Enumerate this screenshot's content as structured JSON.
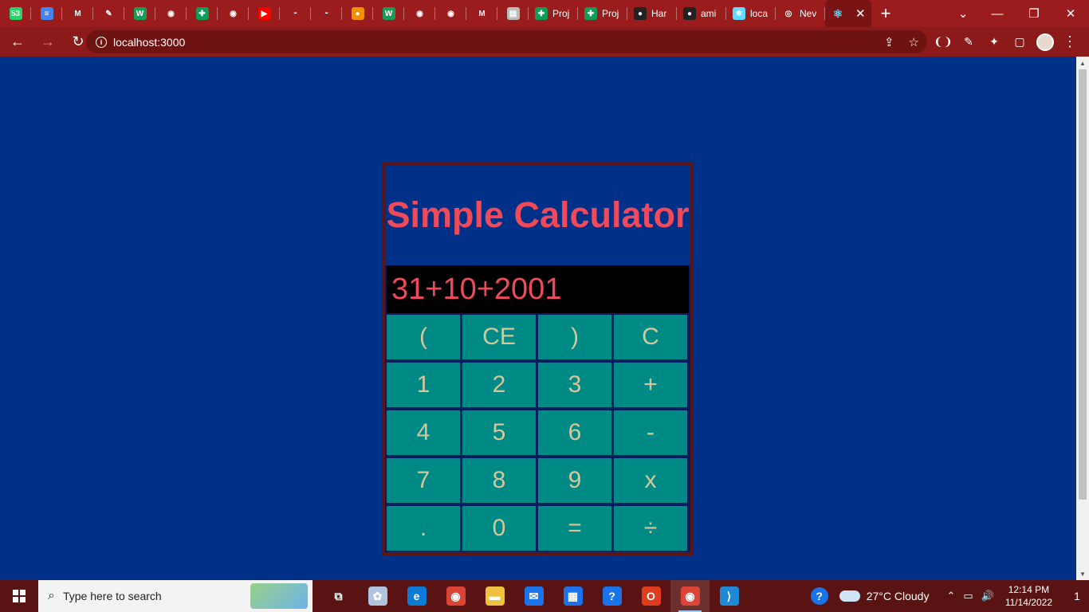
{
  "browser": {
    "tabs": [
      {
        "icon": "whatsapp-icon",
        "color": "#25d366",
        "glyph": "53",
        "label": ""
      },
      {
        "icon": "docs-icon",
        "color": "#4285f4",
        "glyph": "≡",
        "label": ""
      },
      {
        "icon": "gmail-icon",
        "color": "#9b1c1c",
        "glyph": "M",
        "label": ""
      },
      {
        "icon": "pen-icon",
        "color": "#9b1c1c",
        "glyph": "✎",
        "label": ""
      },
      {
        "icon": "w-icon",
        "color": "#1a9c58",
        "glyph": "W",
        "label": ""
      },
      {
        "icon": "globe-icon",
        "color": "#9b1c1c",
        "glyph": "◉",
        "label": ""
      },
      {
        "icon": "sheets-icon",
        "color": "#0f9d58",
        "glyph": "✚",
        "label": ""
      },
      {
        "icon": "globe-icon",
        "color": "#9b1c1c",
        "glyph": "◉",
        "label": ""
      },
      {
        "icon": "youtube-icon",
        "color": "#ff0000",
        "glyph": "▶",
        "label": ""
      },
      {
        "icon": "dash-icon",
        "color": "#9b1c1c",
        "glyph": "⁃",
        "label": ""
      },
      {
        "icon": "dash-icon",
        "color": "#9b1c1c",
        "glyph": "⁃",
        "label": ""
      },
      {
        "icon": "fire-icon",
        "color": "#f29100",
        "glyph": "●",
        "label": ""
      },
      {
        "icon": "w-icon",
        "color": "#1a9c58",
        "glyph": "W",
        "label": ""
      },
      {
        "icon": "globe-icon",
        "color": "#9b1c1c",
        "glyph": "◉",
        "label": ""
      },
      {
        "icon": "globe-icon",
        "color": "#9b1c1c",
        "glyph": "◉",
        "label": ""
      },
      {
        "icon": "gmail-icon",
        "color": "#9b1c1c",
        "glyph": "M",
        "label": ""
      },
      {
        "icon": "file-icon",
        "color": "#bbbbbb",
        "glyph": "▤",
        "label": ""
      },
      {
        "icon": "sheets-icon",
        "color": "#0f9d58",
        "glyph": "✚",
        "label": "Proj"
      },
      {
        "icon": "sheets-icon",
        "color": "#0f9d58",
        "glyph": "✚",
        "label": "Proj"
      },
      {
        "icon": "github-icon",
        "color": "#222222",
        "glyph": "●",
        "label": "Har"
      },
      {
        "icon": "github-icon",
        "color": "#222222",
        "glyph": "●",
        "label": "ami"
      },
      {
        "icon": "react-icon",
        "color": "#61dafb",
        "glyph": "⚛",
        "label": "loca"
      },
      {
        "icon": "chrome-icon",
        "color": "#9b1c1c",
        "glyph": "◎",
        "label": "Nev"
      }
    ],
    "active_tab": {
      "icon": "react-icon",
      "glyph": "⚛",
      "close": "✕"
    },
    "new_tab": "+",
    "window_controls": {
      "dropdown": "⌄",
      "minimize": "—",
      "restore": "❐",
      "close": "✕"
    },
    "nav": {
      "back": "←",
      "forward": "→",
      "reload": "↻"
    },
    "address": {
      "info": "i",
      "url": "localhost:3000"
    },
    "omni_icons": {
      "share": "⇪",
      "bookmark": "☆"
    },
    "extensions": [
      "❨❩",
      "✎",
      "✦",
      "▢"
    ]
  },
  "calculator": {
    "title": "Simple Calculator",
    "display": "31+10+2001",
    "keys": [
      "(",
      "CE",
      ")",
      "C",
      "1",
      "2",
      "3",
      "+",
      "4",
      "5",
      "6",
      "-",
      "7",
      "8",
      "9",
      "x",
      ".",
      "0",
      "=",
      "÷"
    ]
  },
  "taskbar": {
    "search_placeholder": "Type here to search",
    "apps": [
      {
        "name": "task-view-icon",
        "glyph": "⧉",
        "color": "transparent"
      },
      {
        "name": "paint-icon",
        "glyph": "✿",
        "color": "#b0c4de"
      },
      {
        "name": "edge-icon",
        "glyph": "e",
        "color": "#0c7bd6"
      },
      {
        "name": "chrome-icon",
        "glyph": "◉",
        "color": "#db4437"
      },
      {
        "name": "file-explorer-icon",
        "glyph": "▬",
        "color": "#f0c040"
      },
      {
        "name": "mail-icon",
        "glyph": "✉",
        "color": "#1a73e8"
      },
      {
        "name": "store-icon",
        "glyph": "▦",
        "color": "#1a73e8"
      },
      {
        "name": "help-icon",
        "glyph": "?",
        "color": "#1a73e8"
      },
      {
        "name": "office-icon",
        "glyph": "O",
        "color": "#e03c1f"
      },
      {
        "name": "chrome-profile-icon",
        "glyph": "◉",
        "color": "#db4437"
      },
      {
        "name": "vscode-icon",
        "glyph": "⟩",
        "color": "#1e8ad6"
      }
    ],
    "weather": "27°C  Cloudy",
    "tray_glyphs": [
      "⌃",
      "▭",
      "🔊"
    ],
    "time": "12:14 PM",
    "date": "11/14/2022",
    "notifications": "1"
  }
}
